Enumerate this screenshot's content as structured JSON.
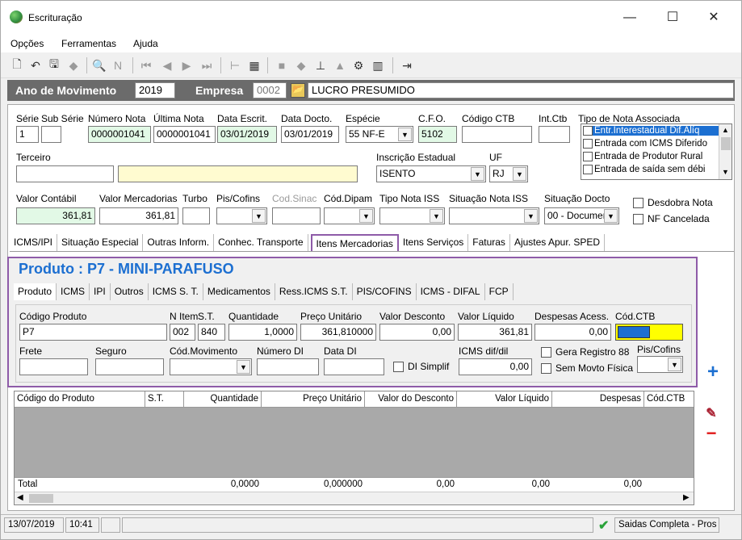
{
  "window": {
    "title": "Escrituração",
    "minimize": "—",
    "maximize": "☐",
    "close": "✕"
  },
  "menu": [
    "Opções",
    "Ferramentas",
    "Ajuda"
  ],
  "yearbar": {
    "ano_label": "Ano de Movimento",
    "ano_value": "2019",
    "empresa_label": "Empresa",
    "empresa_code": "0002",
    "empresa_name": "LUCRO PRESUMIDO"
  },
  "header": {
    "serie_label": "Série",
    "serie_value": "1",
    "subserie_label": "Sub Série",
    "subserie_value": "",
    "numero_label": "Número Nota",
    "numero_value": "0000001041",
    "ultima_label": "Última Nota",
    "ultima_value": "0000001041",
    "data_escrit_label": "Data Escrit.",
    "data_escrit_value": "03/01/2019",
    "data_docto_label": "Data Docto.",
    "data_docto_value": "03/01/2019",
    "especie_label": "Espécie",
    "especie_value": "55  NF-E",
    "cfo_label": "C.F.O.",
    "cfo_value": "5102",
    "ctb_label": "Código CTB",
    "ctb_value": "",
    "intctb_label": "Int.Ctb",
    "intctb_value": "",
    "tipo_label": "Tipo de Nota Associada",
    "tipo_items": [
      "Entr.Interestadual Dif.Alíq",
      "Entrada com ICMS Diferido",
      "Entrada de Produtor Rural",
      "Entrada de saída sem débi"
    ],
    "terceiro_label": "Terceiro",
    "terceiro_value": "",
    "terceiro_name": "",
    "ie_label": "Inscrição Estadual",
    "ie_value": "ISENTO",
    "uf_label": "UF",
    "uf_value": "RJ",
    "valor_contabil_label": "Valor Contábil",
    "valor_contabil_value": "361,81",
    "valor_merc_label": "Valor Mercadorias",
    "valor_merc_value": "361,81",
    "turbo_label": "Turbo",
    "piscofins_label": "Pis/Cofins",
    "cod_sinac_label": "Cod.Sinac",
    "cod_dipam_label": "Cód.Dipam",
    "tipo_iss_label": "Tipo Nota ISS",
    "sit_iss_label": "Situação Nota ISS",
    "sit_docto_label": "Situação Docto",
    "sit_docto_value": "00 - Documen",
    "desdobra_label": "Desdobra Nota",
    "cancelada_label": "NF Cancelada"
  },
  "main_tabs": [
    "ICMS/IPI",
    "Situação Especial",
    "Outras Inform.",
    "Conhec. Transporte",
    "Itens Mercadorias",
    "Itens Serviços",
    "Faturas",
    "Ajustes Apur. SPED"
  ],
  "product": {
    "title": "Produto : P7 - MINI-PARAFUSO",
    "tabs": [
      "Produto",
      "ICMS",
      "IPI",
      "Outros",
      "ICMS S. T.",
      "Medicamentos",
      "Ress.ICMS S.T.",
      "PIS/COFINS",
      "ICMS - DIFAL",
      "FCP"
    ],
    "codigo_label": "Código Produto",
    "codigo_value": "P7",
    "nitem_label": "N Item",
    "nitem_value": "002",
    "st_label": "S.T.",
    "st_value": "840",
    "qtd_label": "Quantidade",
    "qtd_value": "1,0000",
    "preco_label": "Preço Unitário",
    "preco_value": "361,810000",
    "desconto_label": "Valor Desconto",
    "desconto_value": "0,00",
    "liquido_label": "Valor Líquido",
    "liquido_value": "361,81",
    "despesas_label": "Despesas Acess.",
    "despesas_value": "0,00",
    "codctb_label": "Cód.CTB",
    "frete_label": "Frete",
    "seguro_label": "Seguro",
    "codmov_label": "Cód.Movimento",
    "numdi_label": "Número DI",
    "datadi_label": "Data DI",
    "disimplif_label": "DI Simplif",
    "icmsdif_label": "ICMS dif/dil",
    "icmsdif_value": "0,00",
    "gera_label": "Gera Registro 88",
    "semmovto_label": "Sem Movto Física",
    "piscofins_label": "Pis/Cofins"
  },
  "grid": {
    "columns": [
      "Código do Produto",
      "S.T.",
      "Quantidade",
      "Preço Unitário",
      "Valor do Desconto",
      "Valor Líquido",
      "Despesas",
      "Cód.CTB"
    ],
    "total_label": "Total",
    "totals": [
      "0,0000",
      "0,000000",
      "0,00",
      "0,00",
      "0,00"
    ]
  },
  "status": {
    "date": "13/07/2019",
    "time": "10:41",
    "message": "Saidas Completa - Pros"
  },
  "colors": {
    "accent": "#1c6fd1",
    "highlight_box": "#8e5ba8",
    "year_bar": "#6b6b6b"
  }
}
